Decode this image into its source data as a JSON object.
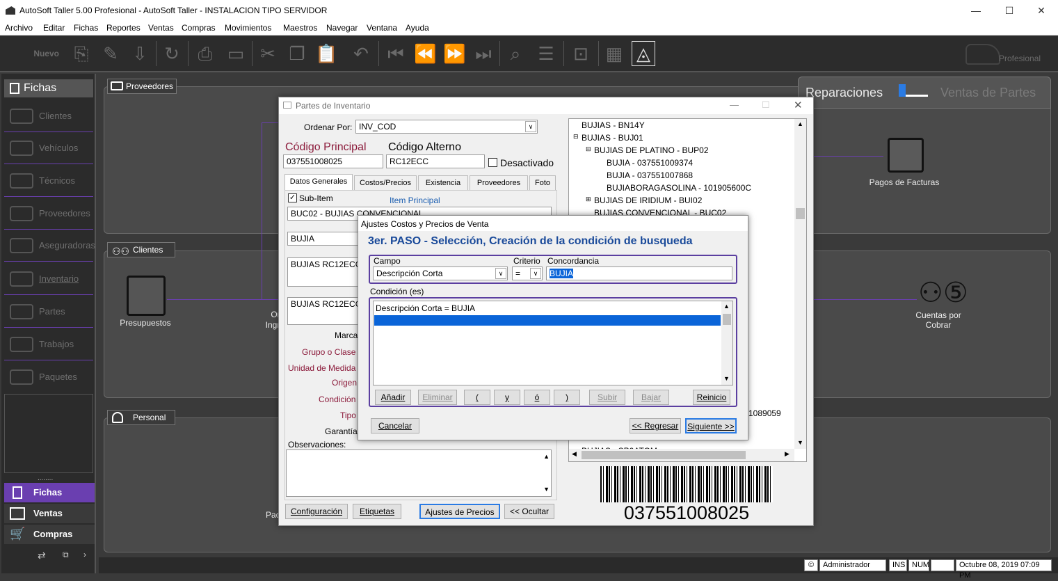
{
  "window": {
    "title": "AutoSoft Taller 5.00 Profesional - AutoSoft Taller - INSTALACION TIPO SERVIDOR",
    "minimize": "—",
    "maximize": "☐",
    "close": "✕"
  },
  "menu": [
    "Archivo",
    "Editar",
    "Fichas",
    "Reportes",
    "Ventas",
    "Compras",
    "Movimientos",
    "Maestros",
    "Navegar",
    "Ventana",
    "Ayuda"
  ],
  "toolbar": {
    "new_label": "Nuevo",
    "edition_label": "Profesional"
  },
  "sidebar": {
    "header": "Fichas",
    "items": [
      "Clientes",
      "Vehículos",
      "Técnicos",
      "Proveedores",
      "Aseguradoras",
      "Inventario",
      "Partes",
      "Trabajos",
      "Paquetes"
    ],
    "grip": "........",
    "bottom": [
      "Fichas",
      "Ventas",
      "Compras"
    ]
  },
  "main": {
    "proveedores": "Proveedores",
    "clientes": "Clientes",
    "personal": "Personal",
    "presupuestos": "Presupuestos",
    "pagos_facturas": "Pagos de Facturas",
    "cuentas_cobrar": "Cuentas por Cobrar",
    "toggle_left": "Reparaciones",
    "toggle_right": "Ventas de Partes",
    "partial_or": "Or",
    "partial_ingr": "Ingr",
    "partial_pac": "Pac"
  },
  "inventory_dialog": {
    "title": "Partes de Inventario",
    "ordenar_label": "Ordenar Por:",
    "ordenar_value": "INV_COD",
    "codigo_principal_label": "Código Principal",
    "codigo_principal_value": "037551008025",
    "codigo_alterno_label": "Código Alterno",
    "codigo_alterno_value": "RC12ECC",
    "desactivado_label": "Desactivado",
    "tabs": [
      "Datos Generales",
      "Costos/Precios",
      "Existencia",
      "Proveedores",
      "Foto"
    ],
    "subitem_label": "Sub-Item",
    "item_principal_label": "Item Principal",
    "item_principal_value": "BUC02 - BUJIAS CONVENCIONAL",
    "desc_short": "BUJIA",
    "desc_long1": "BUJIAS RC12ECC",
    "desc_long2": "BUJIAS RC12ECC",
    "labels": {
      "marca": "Marca",
      "grupo": "Grupo o Clase",
      "unidad": "Unidad de Medida",
      "origen": "Origen",
      "condicion": "Condición",
      "tipo": "Tipo",
      "garantia": "Garantía",
      "observaciones": "Observaciones:"
    },
    "buttons": {
      "configuracion": "Configuración",
      "etiquetas": "Etiquetas",
      "ajustes": "Ajustes de Precios",
      "ocultar": "<< Ocultar"
    },
    "tree": [
      "BUJIAS - BN14Y",
      "BUJIAS - BUJ01",
      "BUJIAS DE PLATINO - BUP02",
      "BUJIA - 037551009374",
      "BUJIA - 037551007868",
      "BUJIABORAGASOLINA - 101905600C",
      "BUJIAS DE IRIDIUM - BUI02",
      "BUJIAS CONVENCIONAL - BUC02"
    ],
    "tree_partial": "1089059",
    "tree_partial_bottom": "BUJIAS - SP0ATOM",
    "barcode_text": "037551008025"
  },
  "wizard": {
    "title": "Ajustes Costos y Precios de Venta",
    "heading": "3er. PASO - Selección, Creación de la condición de busqueda",
    "campo_label": "Campo",
    "campo_value": "Descripción Corta",
    "criterio_label": "Criterio",
    "criterio_value": "=",
    "concordancia_label": "Concordancia",
    "concordancia_value": "BUJIA",
    "condiciones_label": "Condición (es)",
    "condiciones": [
      "Descripción Corta = BUJIA"
    ],
    "buttons": {
      "anadir": "Añadir",
      "eliminar": "Eliminar",
      "paren_open": "(",
      "y": "y",
      "o": "ó",
      "paren_close": ")",
      "subir": "Subir",
      "bajar": "Bajar",
      "reinicio": "Reinicio",
      "cancelar": "Cancelar",
      "regresar": "<< Regresar",
      "siguiente": "Siguiente >>"
    }
  },
  "statusbar": {
    "copyright": "©",
    "user": "Administrador",
    "ins": "INS",
    "num": "NUM",
    "datetime": "Octubre 08, 2019 07:09 PM"
  }
}
